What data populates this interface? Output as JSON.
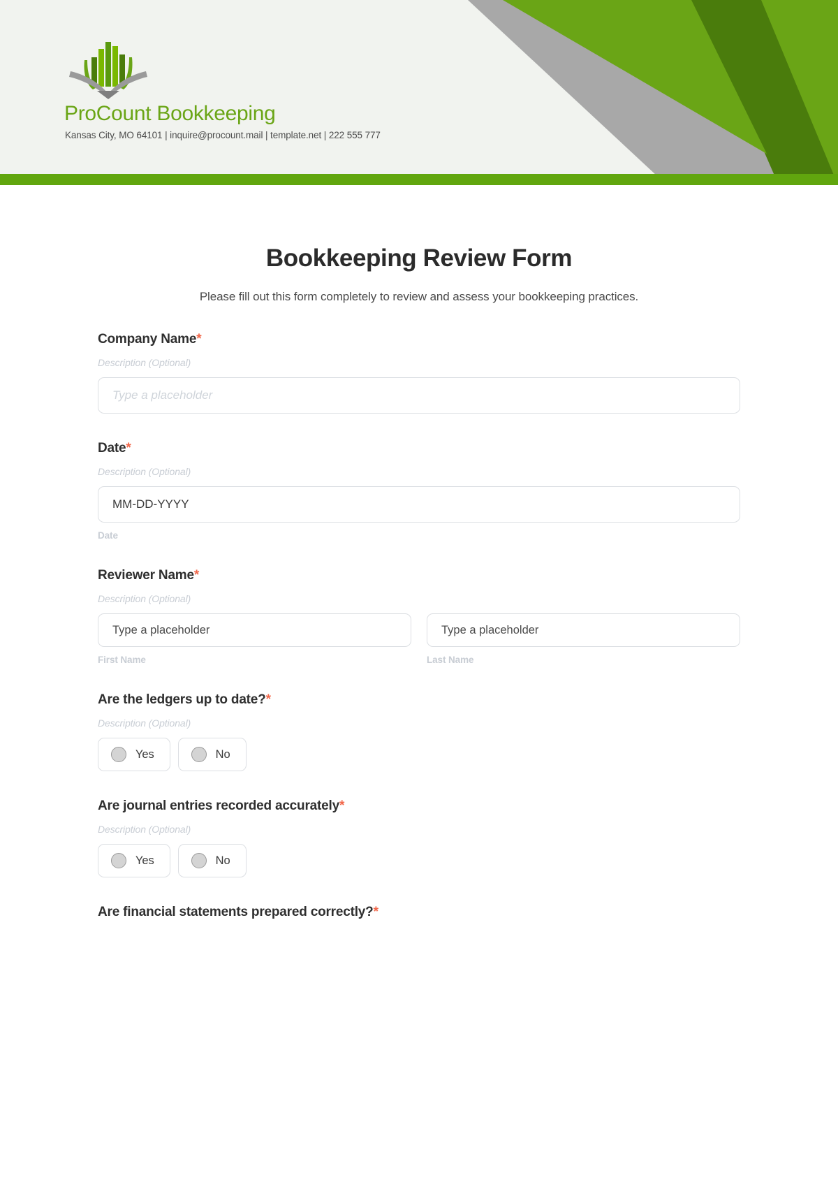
{
  "brand": {
    "name": "ProCount Bookkeeping",
    "contact": "Kansas City, MO 64101 | inquire@procount.mail | template.net | 222 555 777",
    "logo_icon": "bookkeeping-ledger-logo-icon",
    "green": "#61a60e",
    "green_light": "#7ab800",
    "green_dark": "#4a7c0c",
    "gray": "#a8a8a8",
    "banner_bg": "#f1f3ef"
  },
  "form": {
    "title": "Bookkeeping Review Form",
    "subtitle": "Please fill out this form completely to review and assess your bookkeeping practices.",
    "required_marker": "*",
    "description_placeholder": "Description (Optional)",
    "required_color": "#f2674a"
  },
  "fields": [
    {
      "id": "company-name",
      "label": "Company Name",
      "required": true,
      "description": "Description (Optional)",
      "type": "text",
      "placeholder": "Type a placeholder",
      "value": ""
    },
    {
      "id": "date",
      "label": "Date",
      "required": true,
      "description": "Description (Optional)",
      "type": "text",
      "placeholder": "MM-DD-YYYY",
      "value": "MM-DD-YYYY",
      "sub_label": "Date"
    },
    {
      "id": "reviewer-name",
      "label": "Reviewer Name",
      "required": true,
      "description": "Description (Optional)",
      "type": "name",
      "first": {
        "placeholder": "Type a placeholder",
        "value": "Type a placeholder",
        "sub_label": "First Name"
      },
      "last": {
        "placeholder": "Type a placeholder",
        "value": "Type a placeholder",
        "sub_label": "Last Name"
      }
    },
    {
      "id": "ledgers-up-to-date",
      "label": "Are the ledgers up to date?",
      "required": true,
      "description": "Description (Optional)",
      "type": "radio",
      "options": [
        "Yes",
        "No"
      ]
    },
    {
      "id": "journal-entries-accurate",
      "label": "Are journal entries recorded accurately",
      "required": true,
      "description": "Description (Optional)",
      "type": "radio",
      "options": [
        "Yes",
        "No"
      ]
    },
    {
      "id": "financial-statements-correct",
      "label": "Are financial statements prepared correctly?",
      "required": true,
      "type": "label-only"
    }
  ]
}
